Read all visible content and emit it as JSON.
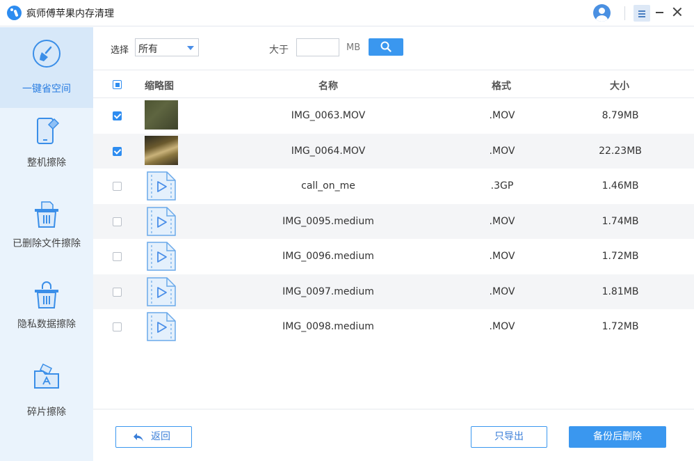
{
  "app": {
    "title": "疯师傅苹果内存清理"
  },
  "sidebar": {
    "items": [
      {
        "label": "一键省空间",
        "icon": "broom-icon",
        "active": true
      },
      {
        "label": "整机擦除",
        "icon": "phone-erase-icon",
        "active": false
      },
      {
        "label": "已删除文件擦除",
        "icon": "trash-file-icon",
        "active": false
      },
      {
        "label": "隐私数据擦除",
        "icon": "lock-trash-icon",
        "active": false
      },
      {
        "label": "碎片擦除",
        "icon": "app-folder-icon",
        "active": false
      }
    ]
  },
  "filter": {
    "select_label": "选择",
    "select_value": "所有",
    "larger_label": "大于",
    "size_value": "",
    "unit": "MB"
  },
  "table": {
    "headers": {
      "thumbnail": "缩略图",
      "name": "名称",
      "format": "格式",
      "size": "大小"
    },
    "rows": [
      {
        "name": "IMG_0063.MOV",
        "format": ".MOV",
        "size": "8.79MB",
        "checked": true,
        "thumb": "video-thumbnail"
      },
      {
        "name": "IMG_0064.MOV",
        "format": ".MOV",
        "size": "22.23MB",
        "checked": true,
        "thumb": "video-thumbnail"
      },
      {
        "name": "call_on_me",
        "format": ".3GP",
        "size": "1.46MB",
        "checked": false,
        "thumb": "video-file-icon"
      },
      {
        "name": "IMG_0095.medium",
        "format": ".MOV",
        "size": "1.74MB",
        "checked": false,
        "thumb": "video-file-icon"
      },
      {
        "name": "IMG_0096.medium",
        "format": ".MOV",
        "size": "1.72MB",
        "checked": false,
        "thumb": "video-file-icon"
      },
      {
        "name": "IMG_0097.medium",
        "format": ".MOV",
        "size": "1.81MB",
        "checked": false,
        "thumb": "video-file-icon"
      },
      {
        "name": "IMG_0098.medium",
        "format": ".MOV",
        "size": "1.72MB",
        "checked": false,
        "thumb": "video-file-icon"
      }
    ]
  },
  "footer": {
    "back_label": "返回",
    "export_label": "只导出",
    "backup_delete_label": "备份后删除"
  },
  "colors": {
    "accent": "#3a97ef",
    "sidebar_bg": "#eaf3fc",
    "sidebar_active": "#d7e8f9"
  }
}
